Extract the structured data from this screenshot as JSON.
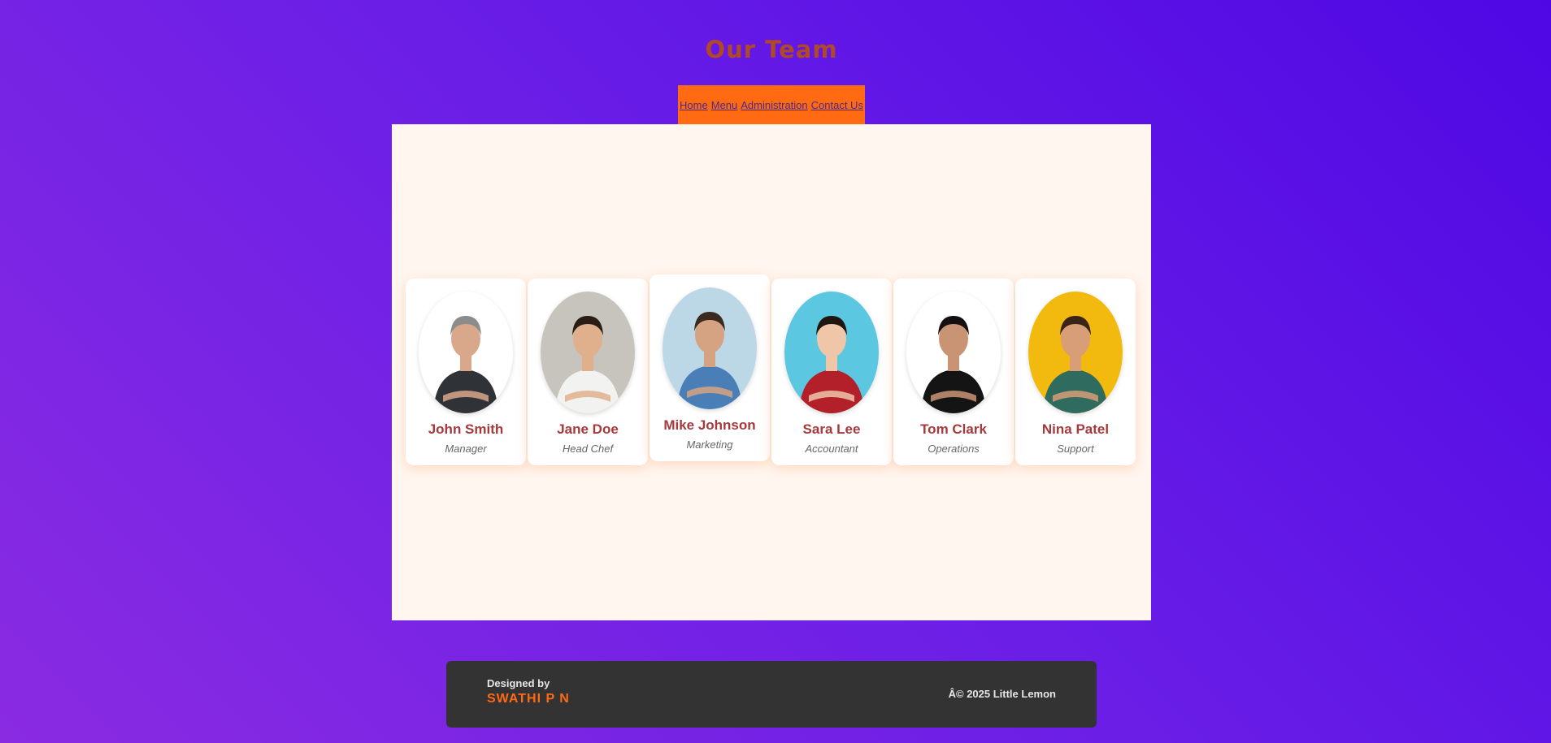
{
  "page": {
    "title": "Our Team"
  },
  "nav": {
    "items": [
      {
        "label": "Home"
      },
      {
        "label": "Menu"
      },
      {
        "label": "Administration"
      },
      {
        "label": "Contact Us"
      }
    ]
  },
  "team": {
    "members": [
      {
        "name": "John Smith",
        "role": "Manager",
        "bg": "#ffffff",
        "shirt": "#2f3236",
        "skin": "#d9a78a",
        "hair": "#8c8c8c"
      },
      {
        "name": "Jane Doe",
        "role": "Head Chef",
        "bg": "#c7c4bd",
        "shirt": "#f2f2f0",
        "skin": "#e0b08c",
        "hair": "#2a1d16"
      },
      {
        "name": "Mike Johnson",
        "role": "Marketing",
        "bg": "#bcd7e6",
        "shirt": "#4a7eb6",
        "skin": "#d5a382",
        "hair": "#3a2a20"
      },
      {
        "name": "Sara Lee",
        "role": "Accountant",
        "bg": "#5bc7e0",
        "shirt": "#b3202a",
        "skin": "#f0c6a8",
        "hair": "#1f1612"
      },
      {
        "name": "Tom Clark",
        "role": "Operations",
        "bg": "#ffffff",
        "shirt": "#141414",
        "skin": "#c99474",
        "hair": "#151010"
      },
      {
        "name": "Nina Patel",
        "role": "Support",
        "bg": "#f2b90f",
        "shirt": "#2f6b5e",
        "skin": "#d79e78",
        "hair": "#3a2418"
      }
    ]
  },
  "footer": {
    "designed_label": "Designed by",
    "designer": "SWATHI P N",
    "copyright": "Â© 2025 Little Lemon"
  },
  "colors": {
    "accent": "#ff6a13",
    "title": "#b04a26",
    "name": "#a5393c",
    "panel": "#fff6ef",
    "footer": "#333333"
  }
}
